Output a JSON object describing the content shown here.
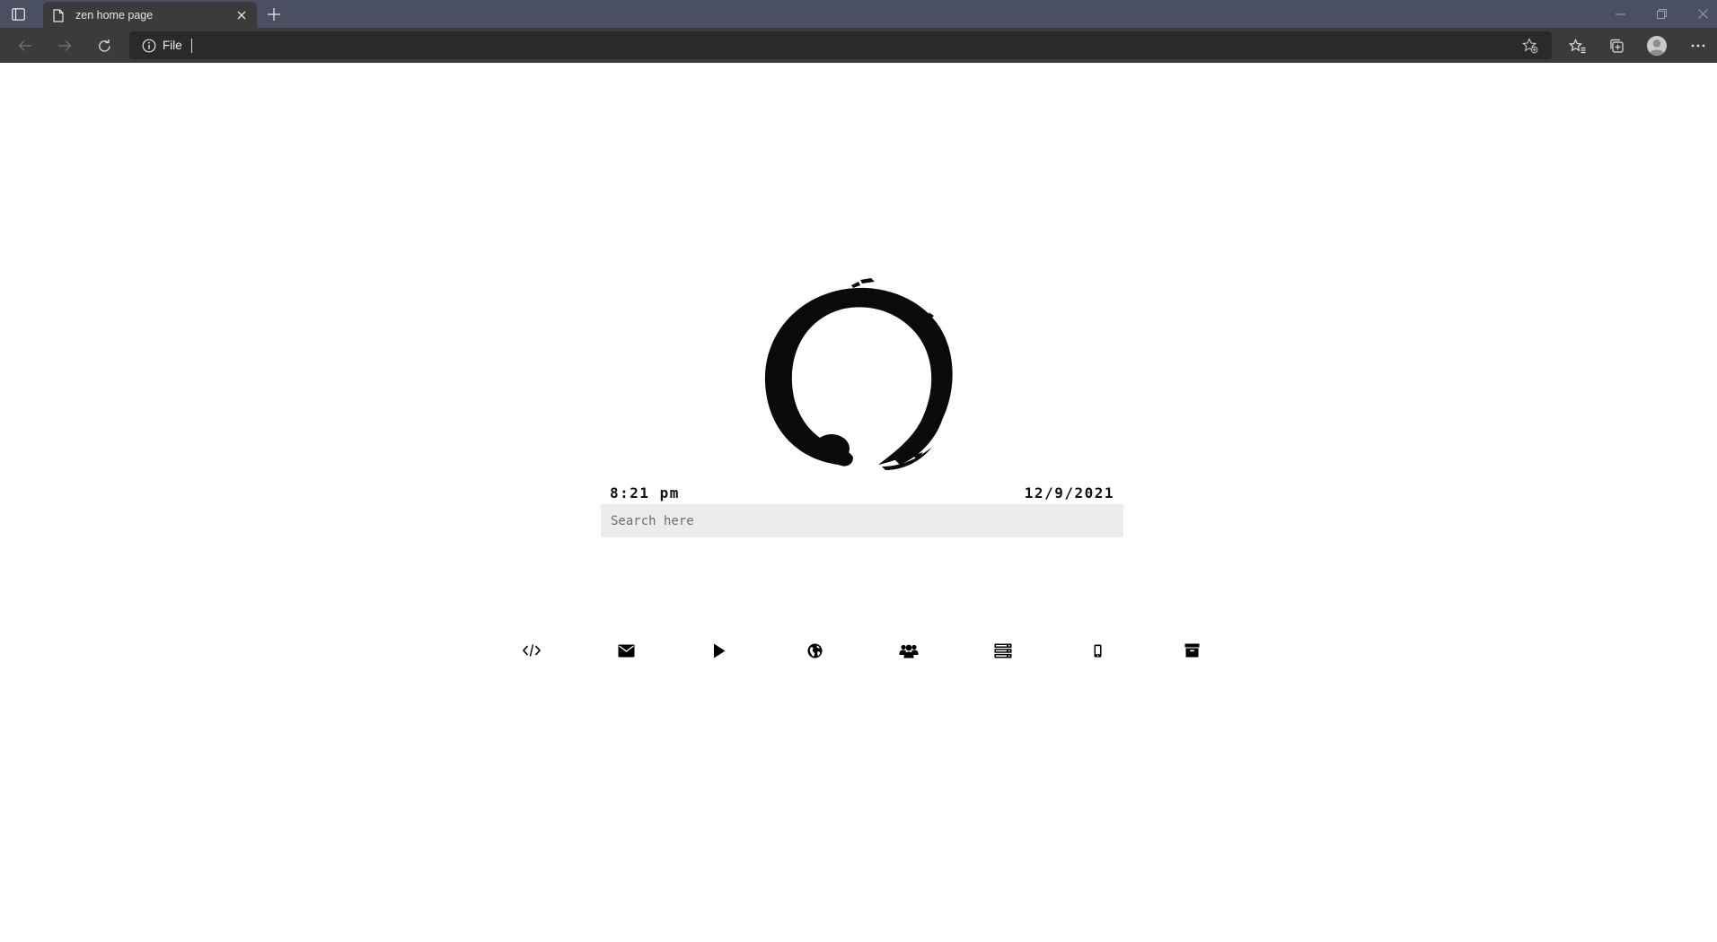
{
  "browser": {
    "tab": {
      "title": "zen home page"
    },
    "address_bar": {
      "scheme_label": "File",
      "value": ""
    },
    "colors": {
      "titlebar": "#4a5062",
      "toolbar": "#3b3b3b",
      "omnibox": "#2a2a2a"
    }
  },
  "page": {
    "logo": "enso-circle",
    "clock": {
      "time": "8:21 pm",
      "date": "12/9/2021"
    },
    "search": {
      "placeholder": "Search here",
      "value": ""
    },
    "links": [
      {
        "icon": "code-icon"
      },
      {
        "icon": "envelope-icon"
      },
      {
        "icon": "play-icon"
      },
      {
        "icon": "globe-icon"
      },
      {
        "icon": "users-icon"
      },
      {
        "icon": "server-icon"
      },
      {
        "icon": "mobile-icon"
      },
      {
        "icon": "archive-icon"
      }
    ]
  }
}
